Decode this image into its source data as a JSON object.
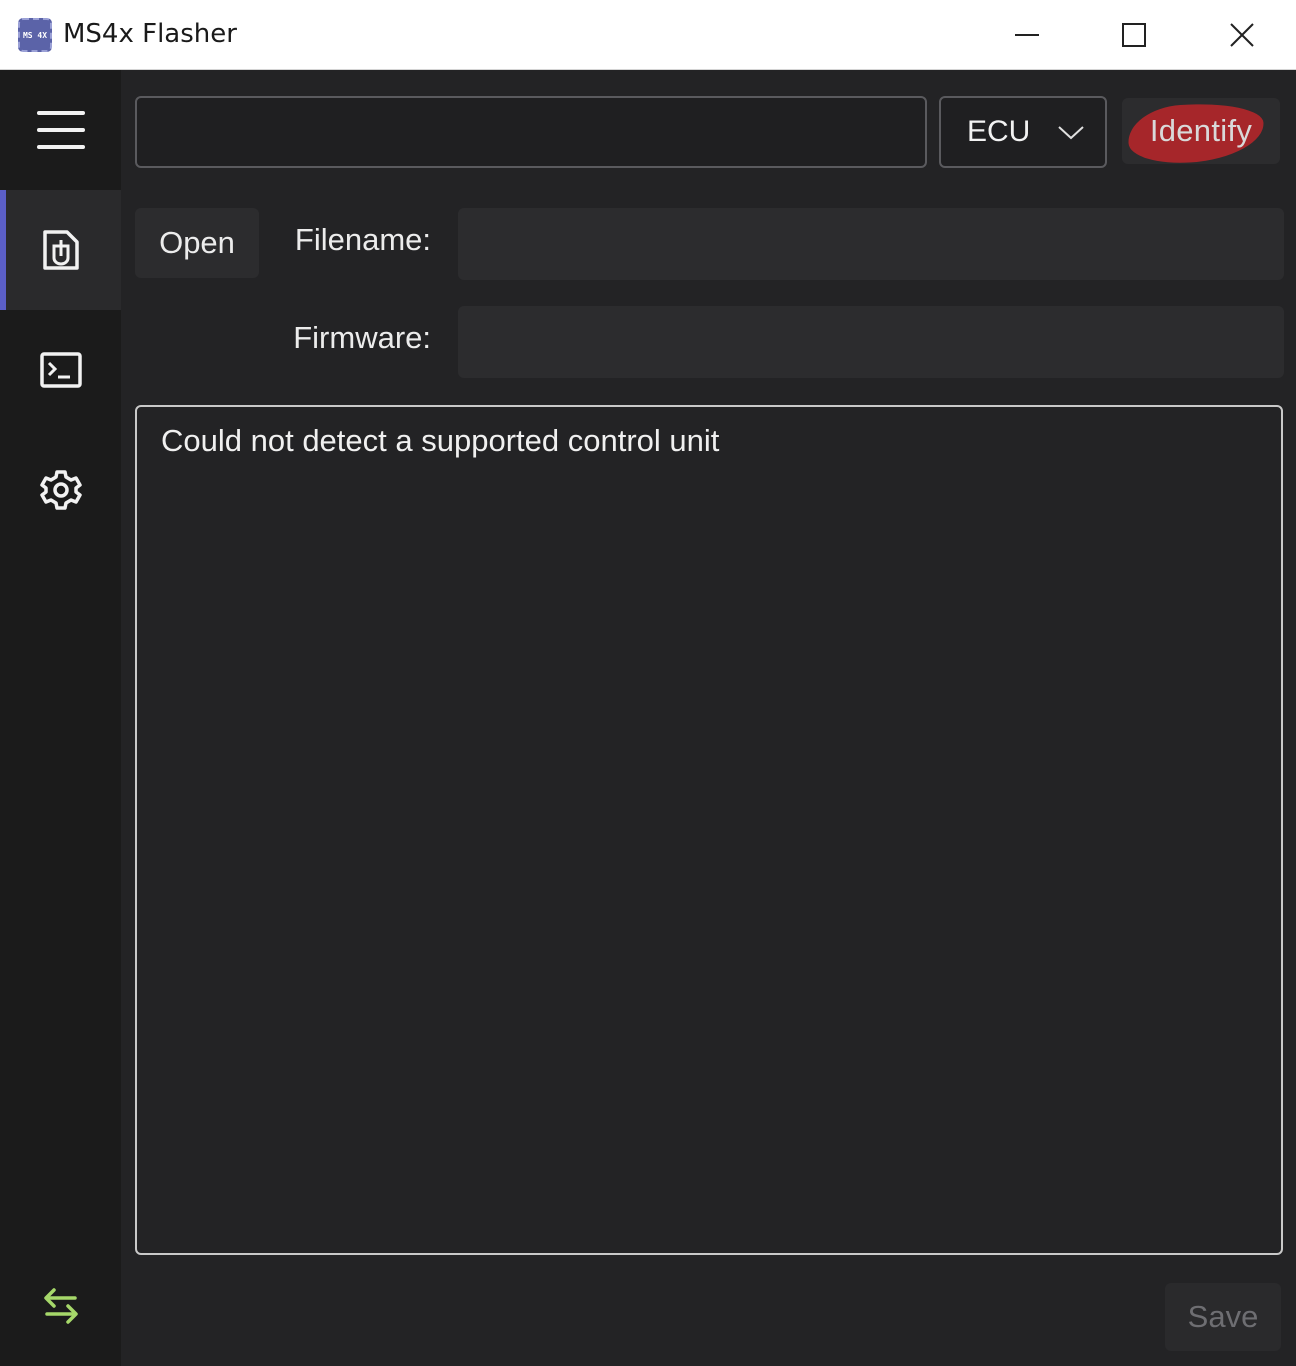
{
  "window": {
    "title": "MS4x Flasher",
    "icon_text": "MS 4X",
    "icon": "chip-icon",
    "controls": [
      "minimize-icon",
      "maximize-icon",
      "close-icon"
    ]
  },
  "sidebar": {
    "items": [
      {
        "icon": "hamburger-menu-icon",
        "active": false
      },
      {
        "icon": "file-flash-icon",
        "active": true
      },
      {
        "icon": "terminal-icon",
        "active": false
      },
      {
        "icon": "gear-icon",
        "active": false
      }
    ],
    "bottom_icon": "swap-arrows-icon",
    "accent": "#5b5fc7",
    "bottom_icon_color": "#a6d86a"
  },
  "toolbar": {
    "port_value": "",
    "ecu_label": "ECU",
    "identify_label": "Identify",
    "identify_highlight_color": "#b4262a"
  },
  "file": {
    "open_label": "Open",
    "filename_label": "Filename:",
    "filename_value": "",
    "firmware_label": "Firmware:",
    "firmware_value": ""
  },
  "log": {
    "message": "Could not detect a supported control unit"
  },
  "footer": {
    "save_label": "Save"
  }
}
